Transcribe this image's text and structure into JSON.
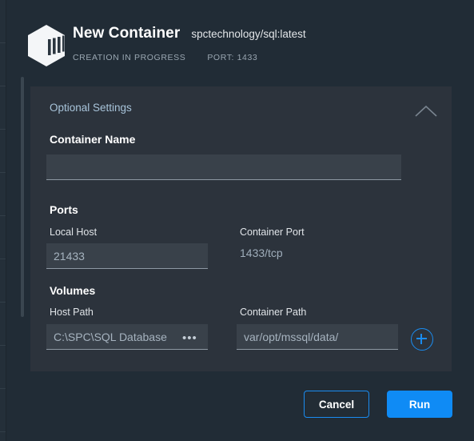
{
  "colors": {
    "page_background": "#212c36",
    "panel_background": "#2c333c",
    "input_background": "#39414a",
    "accent_blue": "#0f8bf5",
    "accent_blue_outline": "#1a8cf0",
    "muted_text": "#9aa7b2"
  },
  "header": {
    "icon": "container-box-icon",
    "title": "New Container",
    "image_tag": "spctechnology/sql:latest",
    "status": "CREATION IN PROGRESS",
    "port_meta": "PORT: 1433"
  },
  "panel": {
    "title": "Optional Settings",
    "collapse_icon": "chevron-up-icon",
    "container_name": {
      "label": "Container Name",
      "value": "",
      "placeholder": ""
    },
    "ports": {
      "section_title": "Ports",
      "local_host": {
        "label": "Local Host",
        "value": "",
        "placeholder": "21433"
      },
      "container_port": {
        "label": "Container Port",
        "value": "1433/tcp"
      }
    },
    "volumes": {
      "section_title": "Volumes",
      "host_path": {
        "label": "Host Path",
        "value": "",
        "placeholder": "C:\\SPC\\SQL Database",
        "browse_icon": "ellipsis-icon",
        "browse_label": "•••"
      },
      "container_path": {
        "label": "Container Path",
        "value": "",
        "placeholder": "var/opt/mssql/data/"
      },
      "add_button_icon": "plus-circle-icon"
    }
  },
  "footer": {
    "cancel_label": "Cancel",
    "run_label": "Run"
  }
}
